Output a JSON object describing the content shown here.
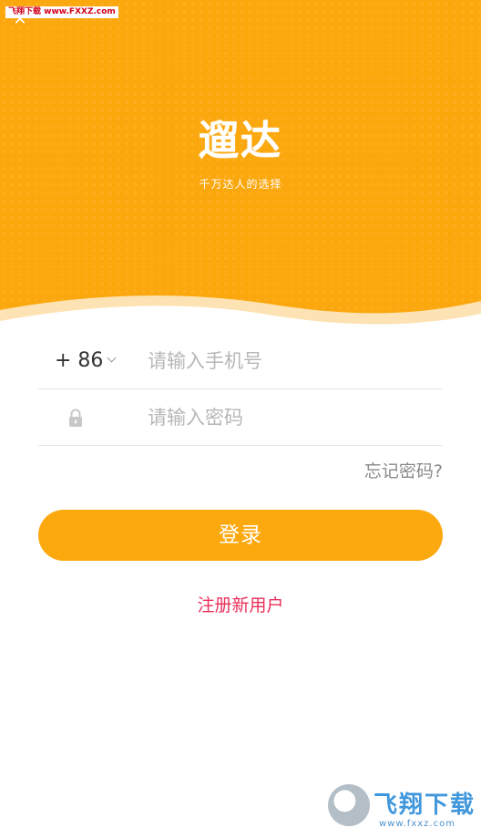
{
  "watermark_top": "飞翔下载 www.FXXZ.com",
  "header": {
    "logo": "遛达",
    "slogan": "千万达人的选择"
  },
  "form": {
    "country_code": "+ 86",
    "phone_placeholder": "请输入手机号",
    "password_placeholder": "请输入密码",
    "forgot_label": "忘记密码?",
    "login_label": "登录",
    "register_label": "注册新用户"
  },
  "watermark_bottom": {
    "text": "飞翔下载",
    "url": "www.fxxz.com"
  },
  "colors": {
    "primary": "#fca80f",
    "register": "#e8305a"
  },
  "icons": {
    "close": "close-icon",
    "lock": "lock-icon",
    "chevron": "chevron-down-icon"
  }
}
